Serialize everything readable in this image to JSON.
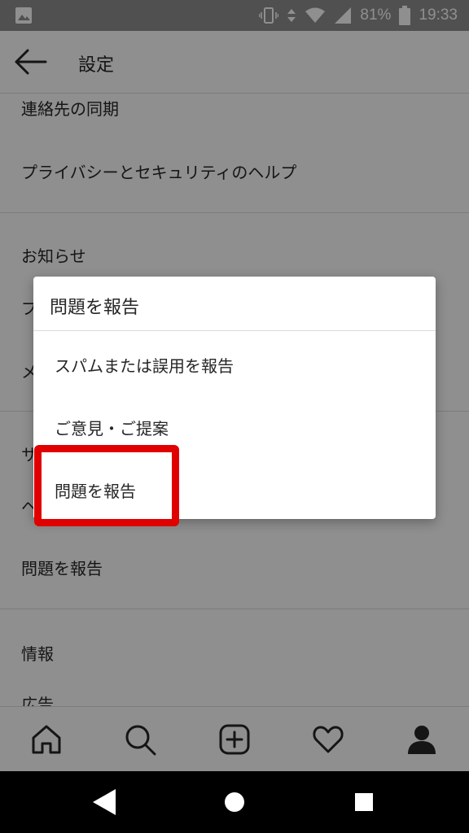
{
  "status_bar": {
    "battery": "81%",
    "time": "19:33"
  },
  "app_bar": {
    "title": "設定"
  },
  "settings_list": {
    "items": [
      "連絡先の同期",
      "プライバシーとセキュリティのヘルプ",
      "お知らせ",
      "プ",
      "メ",
      "サ",
      "ヘ",
      "問題を報告",
      "情報",
      "広告"
    ]
  },
  "dialog": {
    "title": "問題を報告",
    "options": [
      "スパムまたは誤用を報告",
      "ご意見・ご提案",
      "問題を報告"
    ]
  },
  "colors": {
    "highlight": "#e00000",
    "scrim": "rgba(0,0,0,0.44)",
    "status_bar": "#8f8f8f"
  },
  "icons": {
    "tabs": [
      "home-icon",
      "search-icon",
      "add-post-icon",
      "activity-heart-icon",
      "profile-icon"
    ],
    "nav": [
      "back-triangle-icon",
      "home-circle-icon",
      "recents-square-icon"
    ]
  }
}
